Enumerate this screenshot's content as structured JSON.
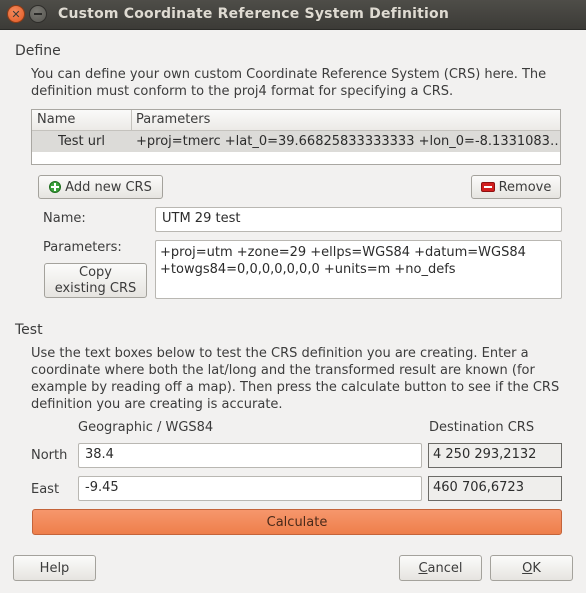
{
  "window": {
    "title": "Custom Coordinate Reference System Definition"
  },
  "define": {
    "group_title": "Define",
    "description_line1": "You can define your own custom Coordinate Reference System (CRS) here. The",
    "description_line2": "definition must conform to the proj4 format for specifying a CRS.",
    "table": {
      "columns": [
        "Name",
        "Parameters"
      ],
      "rows": [
        {
          "name": "Test url",
          "parameters": "+proj=tmerc +lat_0=39.66825833333333 +lon_0=-8.1331083…"
        }
      ]
    },
    "add_button_label": "Add new CRS",
    "remove_button_label": "Remove",
    "name_label": "Name:",
    "name_value": "UTM 29 test",
    "parameters_label": "Parameters:",
    "parameters_line1": "+proj=utm +zone=29 +ellps=WGS84 +datum=WGS84",
    "parameters_line2": "+towgs84=0,0,0,0,0,0,0 +units=m +no_defs",
    "copy_button_line1": "Copy",
    "copy_button_line2": "existing CRS"
  },
  "test": {
    "group_title": "Test",
    "description_lines": [
      "Use the text boxes below to test the CRS definition you are creating. Enter a",
      "coordinate where both the lat/long and the transformed result are known (for",
      "example by reading off a map). Then press the calculate button to see if the CRS",
      "definition you are creating is accurate."
    ],
    "geographic_header": "Geographic / WGS84",
    "destination_header": "Destination CRS",
    "north_label": "North",
    "east_label": "East",
    "north_value": "38.4",
    "east_value": "-9.45",
    "north_result": "4 250 293,2132",
    "east_result": "460 706,6723",
    "calculate_label": "Calculate"
  },
  "footer": {
    "help_label": "Help",
    "cancel_underlined": "C",
    "cancel_rest": "ancel",
    "ok_underlined": "O",
    "ok_rest": "K"
  }
}
